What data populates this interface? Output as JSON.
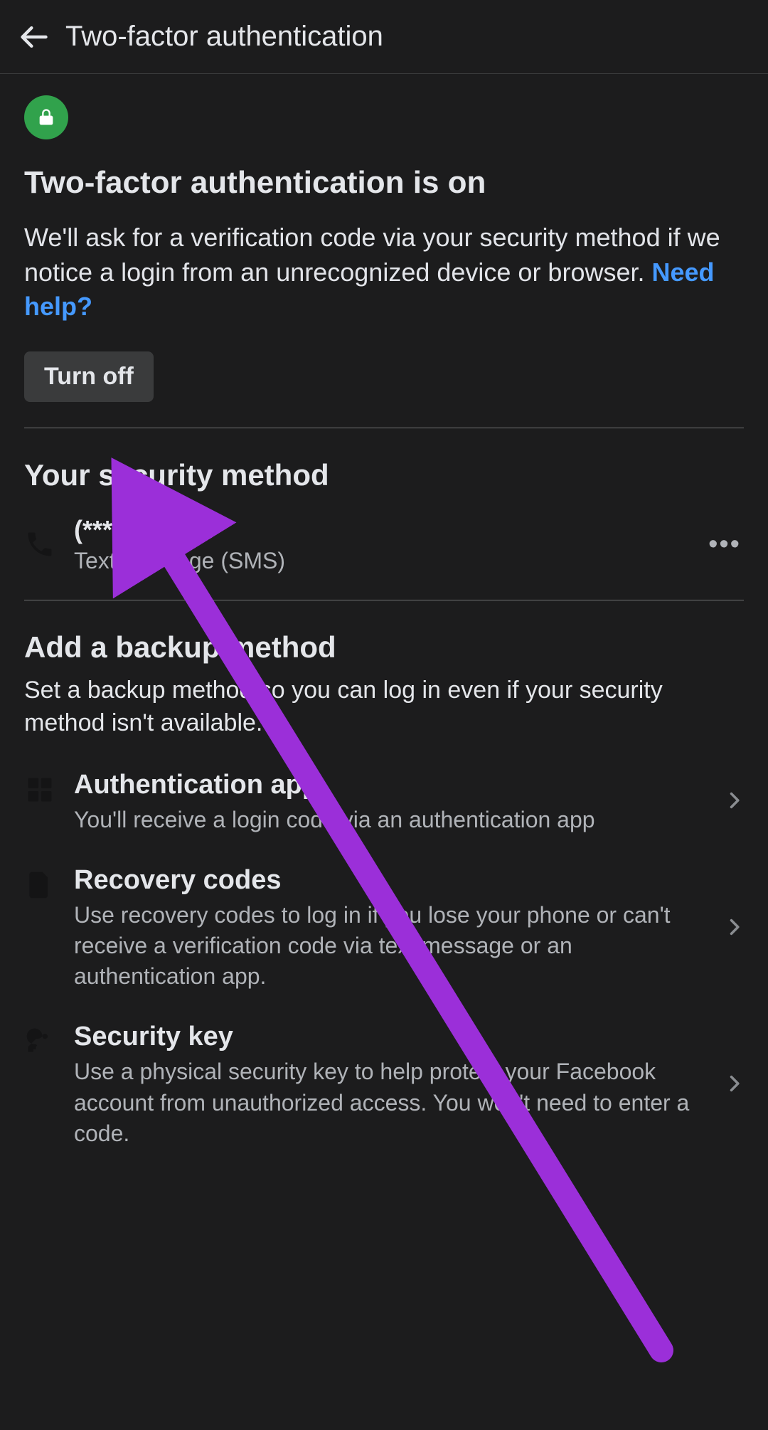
{
  "header": {
    "title": "Two-factor authentication"
  },
  "status": {
    "title": "Two-factor authentication is on",
    "description": "We'll ask for a verification code via your security method if we notice a login from an unrecognized device or browser. ",
    "help_link": "Need help?",
    "turn_off_label": "Turn off"
  },
  "security_method": {
    "section_title": "Your security method",
    "primary": "(***) ***-**15",
    "secondary": "Text message (SMS)"
  },
  "backup": {
    "section_title": "Add a backup method",
    "section_desc": "Set a backup method so you can log in even if your security method isn't available.",
    "items": [
      {
        "title": "Authentication app",
        "desc": "You'll receive a login code via an authentication app"
      },
      {
        "title": "Recovery codes",
        "desc": "Use recovery codes to log in if you lose your phone or can't receive a verification code via text message or an authentication app."
      },
      {
        "title": "Security key",
        "desc": "Use a physical security key to help protect your Facebook account from unauthorized access. You won't need to enter a code."
      }
    ]
  },
  "annotation": {
    "arrow_color": "#9b2fd9"
  }
}
